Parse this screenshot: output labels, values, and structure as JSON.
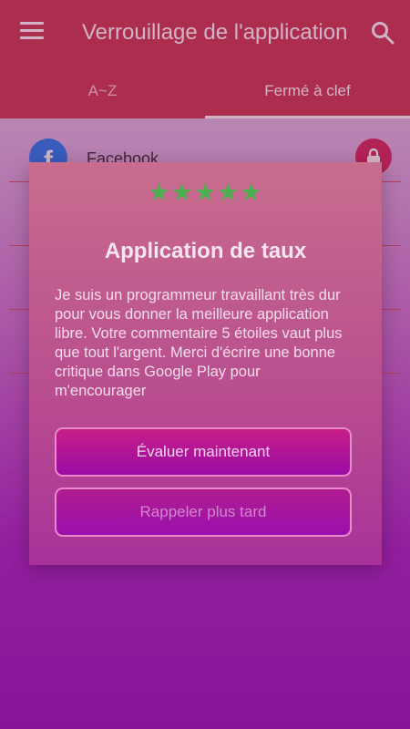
{
  "appbar": {
    "title": "Verrouillage de l'application",
    "menu_icon": "menu-icon",
    "search_icon": "search-icon",
    "color": "#c9304a"
  },
  "tabs": [
    {
      "label": "A~Z",
      "active": false
    },
    {
      "label": "Fermé à clef",
      "active": true
    }
  ],
  "list": {
    "items": [
      {
        "name": "Facebook",
        "icon": "facebook-icon",
        "locked": true
      }
    ]
  },
  "dialog": {
    "stars": "★★★★★",
    "star_count": 5,
    "star_color": "#4caf50",
    "title": "Application de taux",
    "message": "Je suis un programmeur travaillant très dur pour vous donner la meilleure application libre. Votre commentaire 5 étoiles vaut plus que tout l'argent. Merci d'écrire une bonne critique dans Google Play pour m'encourager",
    "rate_label": "Évaluer maintenant",
    "later_label": "Rappeler plus tard"
  }
}
